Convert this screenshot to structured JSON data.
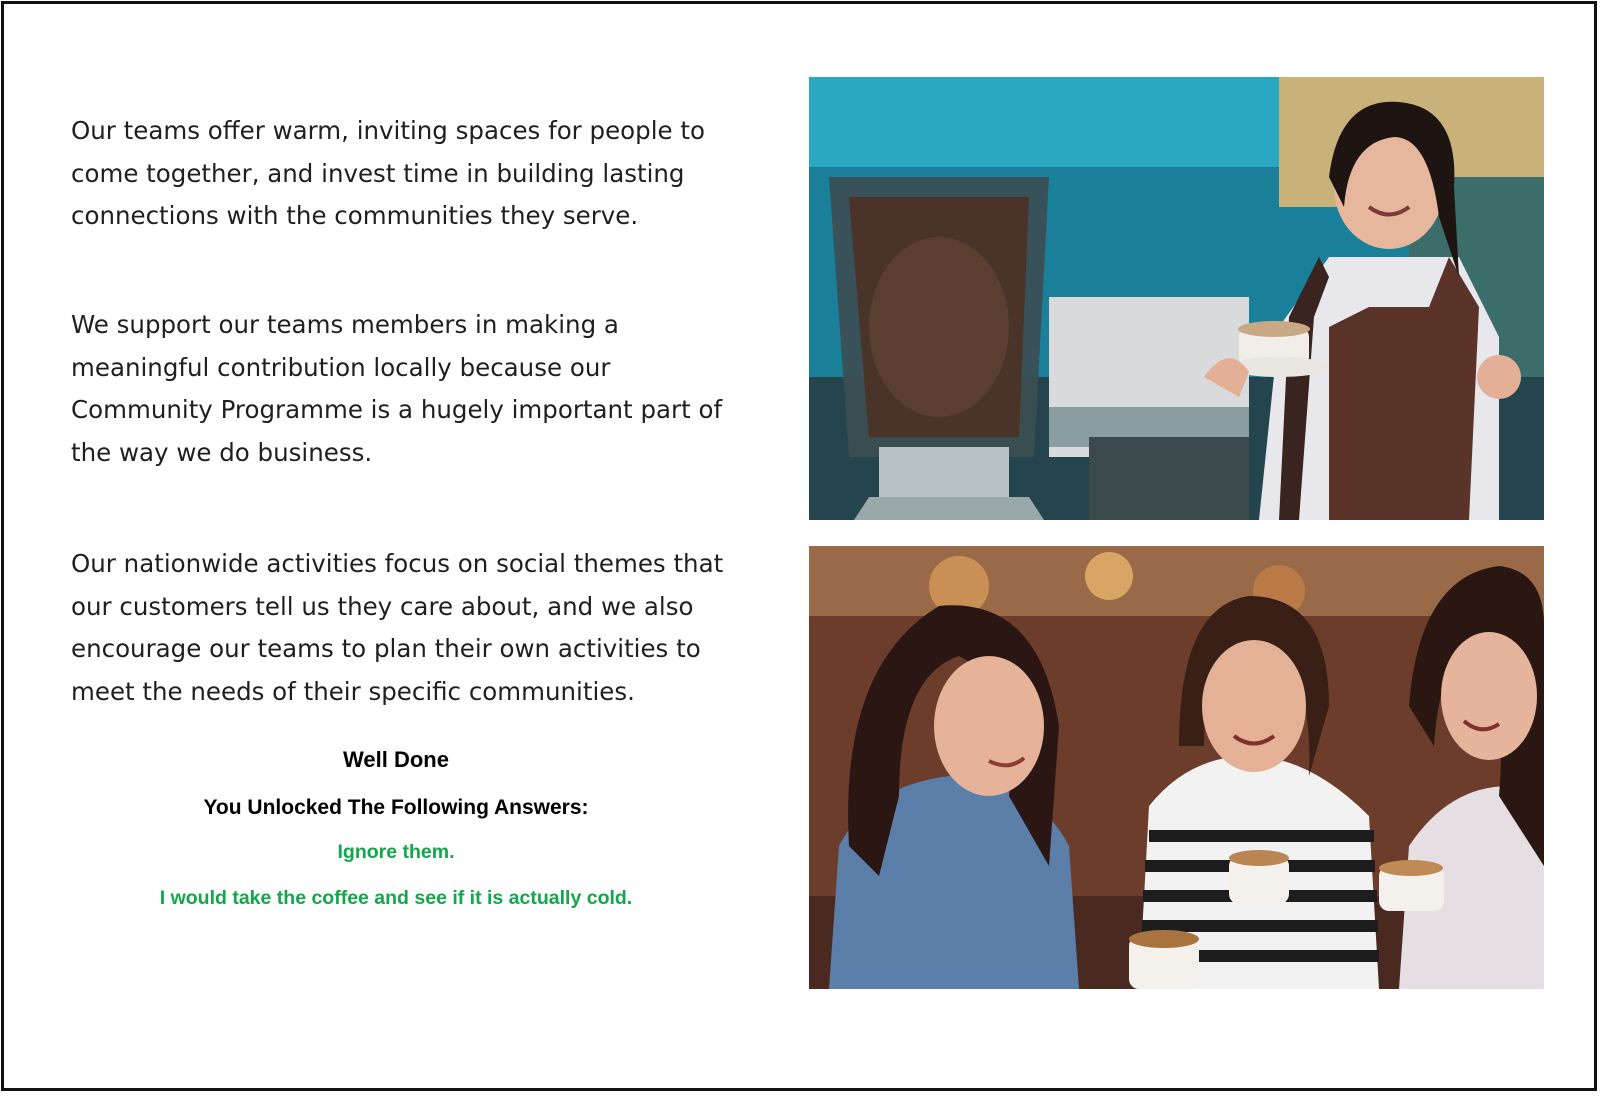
{
  "paragraphs": {
    "p1": "Our teams offer warm, inviting spaces for people to come together, and invest time in building lasting connections with the communities they serve.",
    "p2": "We support our teams members in making a meaningful contribution locally because our Community Programme is a hugely important part of the way we do business.",
    "p3": "Our nationwide activities focus on social themes that our customers tell us they care about, and we also encourage our teams to plan their own activities to meet the needs of their specific communities."
  },
  "result": {
    "well_done": "Well Done",
    "unlocked_heading": "You Unlocked The Following Answers:",
    "answers": [
      "Ignore them.",
      "I would take the coffee and see if it is actually cold."
    ]
  },
  "colors": {
    "answer_green": "#12a84a",
    "frame_border": "#111111"
  },
  "icons": {
    "photo_top": "barista-photo",
    "photo_bottom": "friends-coffee-photo"
  }
}
